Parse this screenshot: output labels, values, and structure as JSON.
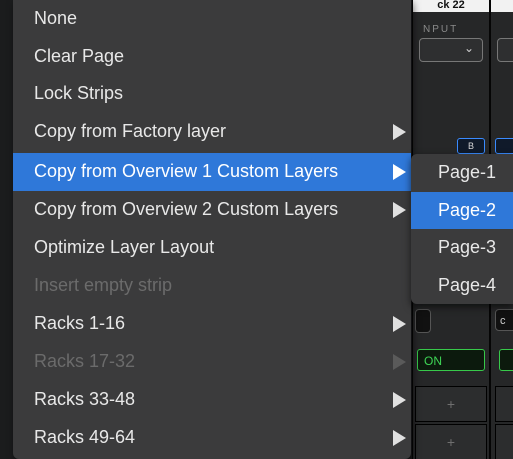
{
  "background": {
    "strip_header_text": "ck 22",
    "input_label": "NPUT",
    "button_b_label": "B",
    "on_button_label": "ON",
    "partial_label": "c",
    "add_slot_symbol": "+"
  },
  "context_menu": {
    "items": [
      {
        "label": "None",
        "enabled": true,
        "selected": false,
        "has_submenu": false
      },
      {
        "label": "Clear Page",
        "enabled": true,
        "selected": false,
        "has_submenu": false
      },
      {
        "label": "Lock Strips",
        "enabled": true,
        "selected": false,
        "has_submenu": false
      },
      {
        "label": "Copy from Factory layer",
        "enabled": true,
        "selected": false,
        "has_submenu": true
      },
      {
        "label": "Copy from Overview 1 Custom Layers",
        "enabled": true,
        "selected": true,
        "has_submenu": true
      },
      {
        "label": "Copy from Overview 2 Custom Layers",
        "enabled": true,
        "selected": false,
        "has_submenu": true
      },
      {
        "label": "Optimize Layer Layout",
        "enabled": true,
        "selected": false,
        "has_submenu": false
      },
      {
        "label": "Insert empty strip",
        "enabled": false,
        "selected": false,
        "has_submenu": false
      },
      {
        "label": "Racks 1-16",
        "enabled": true,
        "selected": false,
        "has_submenu": true
      },
      {
        "label": "Racks 17-32",
        "enabled": false,
        "selected": false,
        "has_submenu": true
      },
      {
        "label": "Racks 33-48",
        "enabled": true,
        "selected": false,
        "has_submenu": true
      },
      {
        "label": "Racks 49-64",
        "enabled": true,
        "selected": false,
        "has_submenu": true
      }
    ]
  },
  "submenu": {
    "items": [
      {
        "label": "Page-1",
        "selected": false
      },
      {
        "label": "Page-2",
        "selected": true
      },
      {
        "label": "Page-3",
        "selected": false
      },
      {
        "label": "Page-4",
        "selected": false
      }
    ]
  },
  "colors": {
    "menu_bg": "#3b3b3c",
    "highlight": "#2f78d9",
    "text": "#e8e8e8",
    "disabled_text": "#6b6b6b",
    "on_green": "#37c94a",
    "button_blue": "#3a8bff"
  }
}
